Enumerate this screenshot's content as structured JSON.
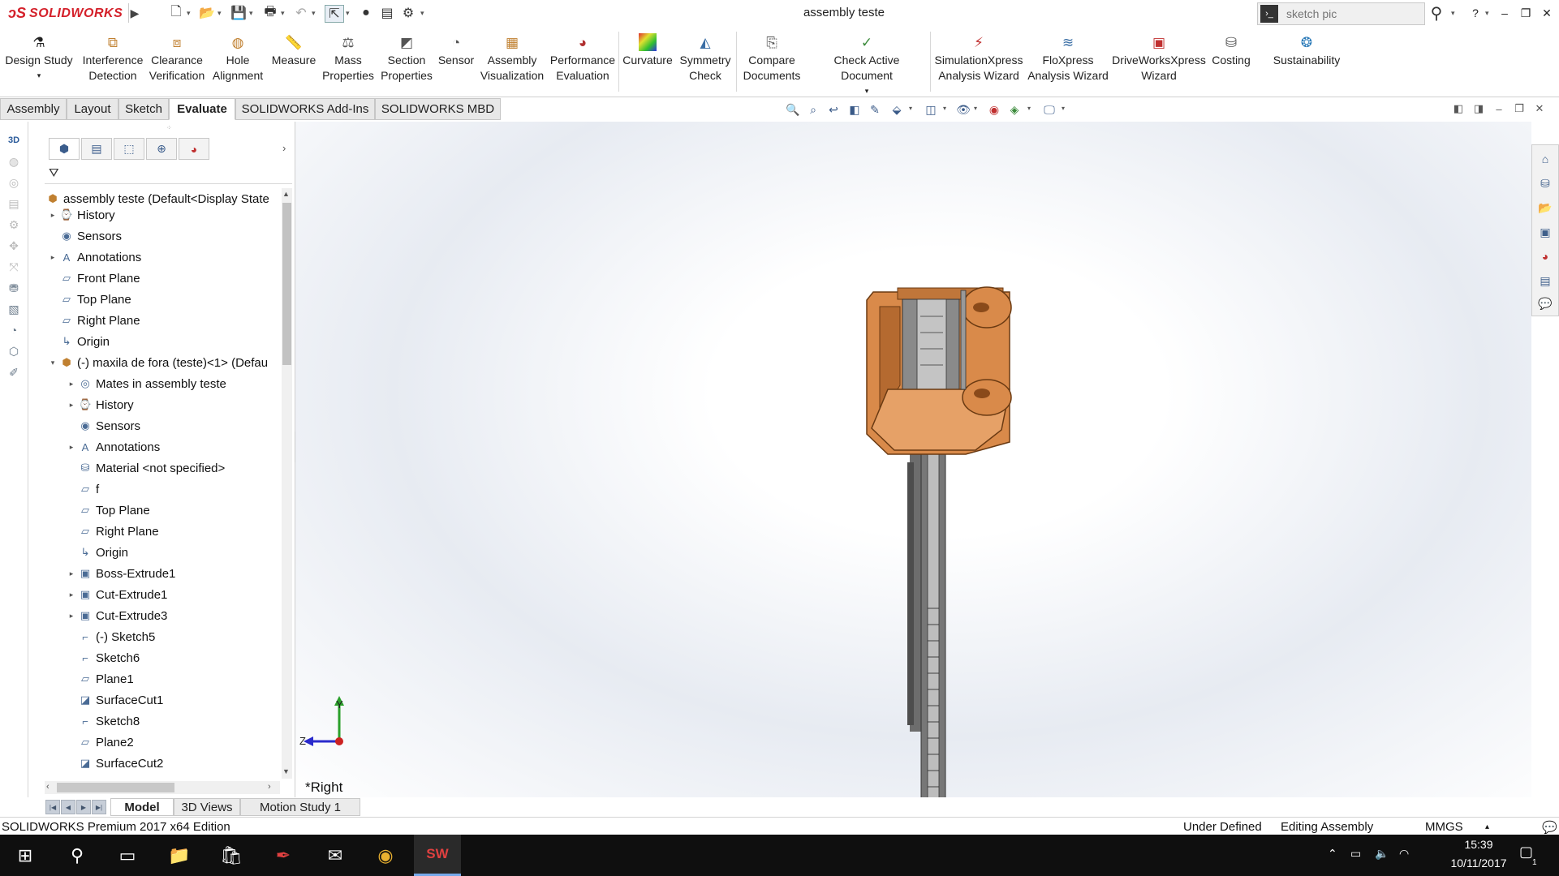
{
  "app": {
    "brand": "SOLIDWORKS",
    "window_title": "assembly teste",
    "search_placeholder": "sketch pic",
    "help": "?",
    "win_min": "–",
    "win_restore": "❐",
    "win_close": "✕"
  },
  "ribbon": {
    "items": [
      {
        "label": "Design Study",
        "label2": "",
        "icon": "design-study-icon"
      },
      {
        "label": "Interference",
        "label2": "Detection",
        "icon": "interference-detection-icon"
      },
      {
        "label": "Clearance",
        "label2": "Verification",
        "icon": "clearance-verification-icon"
      },
      {
        "label": "Hole",
        "label2": "Alignment",
        "icon": "hole-alignment-icon"
      },
      {
        "label": "Measure",
        "label2": "",
        "icon": "measure-icon"
      },
      {
        "label": "Mass",
        "label2": "Properties",
        "icon": "mass-properties-icon"
      },
      {
        "label": "Section",
        "label2": "Properties",
        "icon": "section-properties-icon"
      },
      {
        "label": "Sensor",
        "label2": "",
        "icon": "sensor-icon"
      },
      {
        "label": "Assembly",
        "label2": "Visualization",
        "icon": "assembly-visualization-icon"
      },
      {
        "label": "Performance",
        "label2": "Evaluation",
        "icon": "performance-evaluation-icon"
      },
      {
        "label": "Curvature",
        "label2": "",
        "icon": "curvature-icon"
      },
      {
        "label": "Symmetry",
        "label2": "Check",
        "icon": "symmetry-check-icon"
      },
      {
        "label": "Compare",
        "label2": "Documents",
        "icon": "compare-documents-icon"
      },
      {
        "label": "Check Active Document",
        "label2": "",
        "icon": "check-active-document-icon"
      },
      {
        "label": "SimulationXpress",
        "label2": "Analysis Wizard",
        "icon": "simulationxpress-icon"
      },
      {
        "label": "FloXpress",
        "label2": "Analysis Wizard",
        "icon": "floxpress-icon"
      },
      {
        "label": "DriveWorksXpress",
        "label2": "Wizard",
        "icon": "driveworksxpress-icon"
      },
      {
        "label": "Costing",
        "label2": "",
        "icon": "costing-icon"
      },
      {
        "label": "Sustainability",
        "label2": "",
        "icon": "sustainability-icon"
      }
    ]
  },
  "tabs": [
    "Assembly",
    "Layout",
    "Sketch",
    "Evaluate",
    "SOLIDWORKS Add-Ins",
    "SOLIDWORKS MBD"
  ],
  "active_tab": "Evaluate",
  "tree": {
    "root": "assembly teste  (Default<Display State",
    "items": [
      {
        "label": "History",
        "icon": "history-icon"
      },
      {
        "label": "Sensors",
        "icon": "sensors-icon"
      },
      {
        "label": "Annotations",
        "icon": "annotations-icon"
      },
      {
        "label": "Front Plane",
        "icon": "plane-icon"
      },
      {
        "label": "Top Plane",
        "icon": "plane-icon"
      },
      {
        "label": "Right Plane",
        "icon": "plane-icon"
      },
      {
        "label": "Origin",
        "icon": "origin-icon"
      },
      {
        "label": "(-) maxila de fora (teste)<1> (Defau",
        "icon": "part-icon"
      },
      {
        "label": "Mates in assembly teste",
        "icon": "mates-icon"
      },
      {
        "label": "History",
        "icon": "history-icon"
      },
      {
        "label": "Sensors",
        "icon": "sensors-icon"
      },
      {
        "label": "Annotations",
        "icon": "annotations-icon"
      },
      {
        "label": "Material <not specified>",
        "icon": "material-icon"
      },
      {
        "label": "f",
        "icon": "plane-icon"
      },
      {
        "label": "Top Plane",
        "icon": "plane-icon"
      },
      {
        "label": "Right Plane",
        "icon": "plane-icon"
      },
      {
        "label": "Origin",
        "icon": "origin-icon"
      },
      {
        "label": "Boss-Extrude1",
        "icon": "boss-extrude-icon"
      },
      {
        "label": "Cut-Extrude1",
        "icon": "cut-extrude-icon"
      },
      {
        "label": "Cut-Extrude3",
        "icon": "cut-extrude-icon"
      },
      {
        "label": "(-) Sketch5",
        "icon": "sketch-icon"
      },
      {
        "label": "Sketch6",
        "icon": "sketch-icon"
      },
      {
        "label": "Plane1",
        "icon": "plane-icon"
      },
      {
        "label": "SurfaceCut1",
        "icon": "surface-cut-icon"
      },
      {
        "label": "Sketch8",
        "icon": "sketch-icon"
      },
      {
        "label": "Plane2",
        "icon": "plane-icon"
      },
      {
        "label": "SurfaceCut2",
        "icon": "surface-cut-icon"
      }
    ]
  },
  "viewport": {
    "view_name": "*Right",
    "axis_y": "Y",
    "axis_z": "Z"
  },
  "bottom_tabs": [
    "Model",
    "3D Views",
    "Motion Study 1"
  ],
  "active_bottom_tab": "Model",
  "status": {
    "edition": "SOLIDWORKS Premium 2017 x64 Edition",
    "state": "Under Defined",
    "mode": "Editing Assembly",
    "units": "MMGS"
  },
  "taskbar": {
    "time": "15:39",
    "date": "10/11/2017",
    "notif_count": "1"
  },
  "colors": {
    "brand_red": "#d4202a",
    "part_orange": "#d98a4a",
    "rod_gray": "#6d6d6d"
  }
}
